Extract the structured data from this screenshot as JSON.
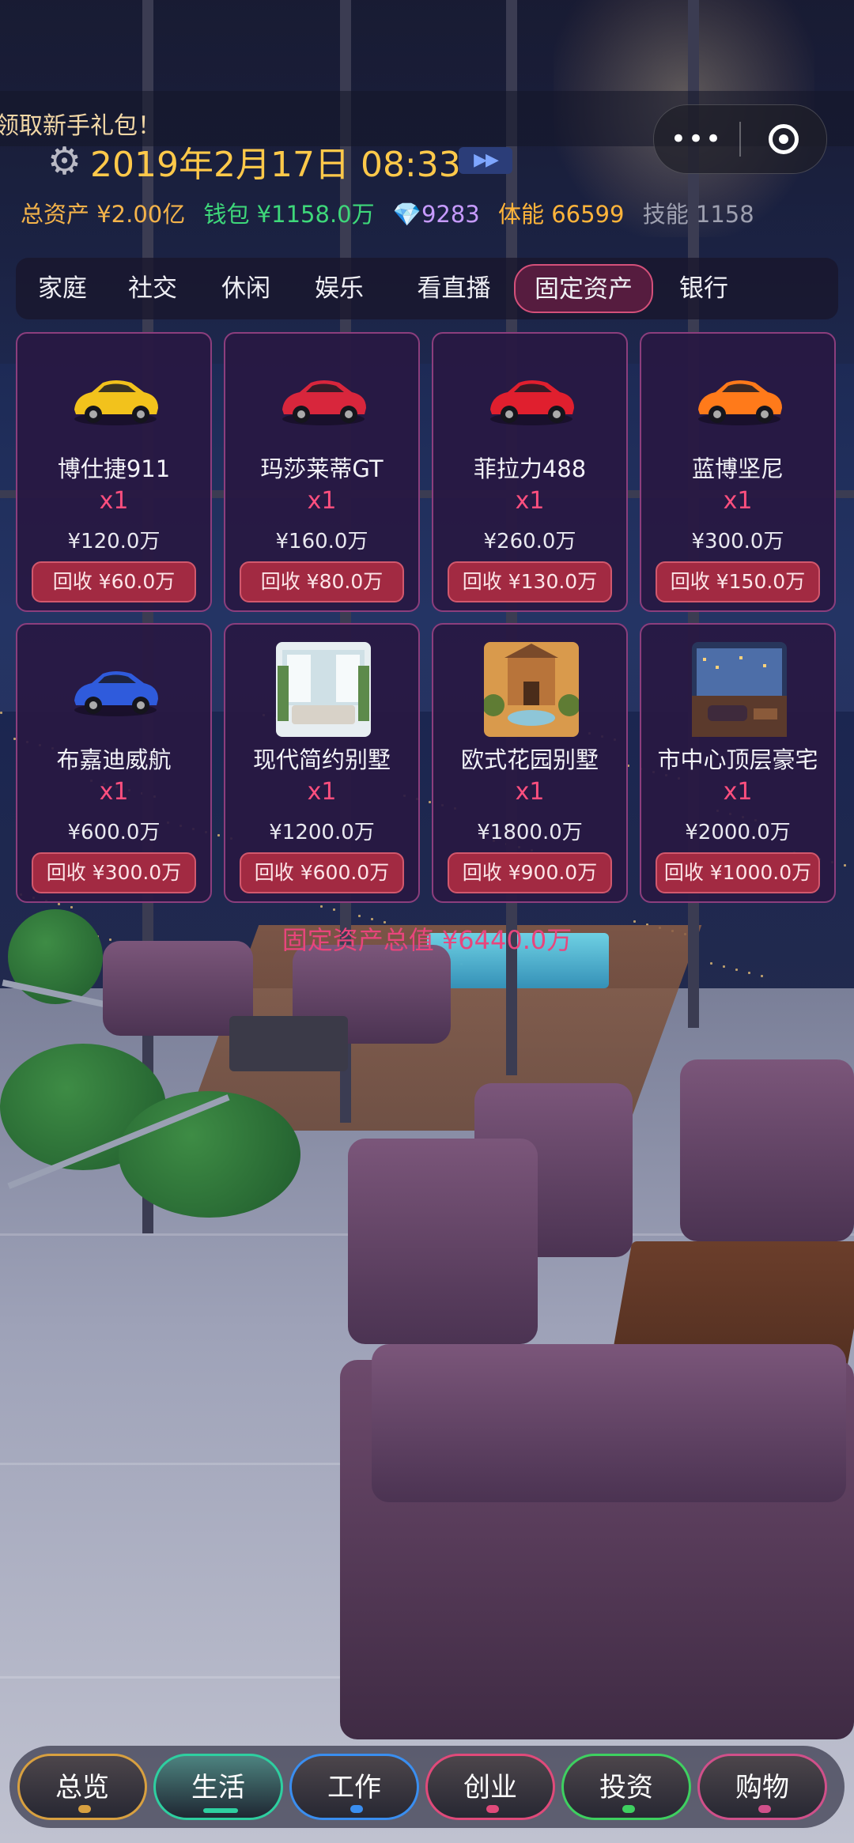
{
  "ticker": "领取新手礼包！",
  "capsule": {
    "more": "•••"
  },
  "header": {
    "date": "2019年2月17日 08:33",
    "speed": "▶▶"
  },
  "stats": {
    "total": "总资产 ¥2.00亿",
    "wallet": "钱包 ¥1158.0万",
    "gems": "💎9283",
    "stamina": "体能 66599",
    "skill": "技能 1158"
  },
  "tabs": [
    "家庭",
    "社交",
    "休闲",
    "娱乐",
    "看直播",
    "固定资产",
    "银行"
  ],
  "active_tab": "固定资产",
  "assets": [
    {
      "name": "博仕捷911",
      "qty": "x1",
      "price": "¥120.0万",
      "sell": "回收 ¥60.0万",
      "icon": "yellow-sports-car-icon",
      "color": "#f2c21c"
    },
    {
      "name": "玛莎莱蒂GT",
      "qty": "x1",
      "price": "¥160.0万",
      "sell": "回收 ¥80.0万",
      "icon": "red-coupe-icon",
      "color": "#d8263c"
    },
    {
      "name": "菲拉力488",
      "qty": "x1",
      "price": "¥260.0万",
      "sell": "回收 ¥130.0万",
      "icon": "red-supercar-icon",
      "color": "#e01f2e"
    },
    {
      "name": "蓝博坚尼",
      "qty": "x1",
      "price": "¥300.0万",
      "sell": "回收 ¥150.0万",
      "icon": "orange-supercar-icon",
      "color": "#ff7a1a"
    },
    {
      "name": "布嘉迪威航",
      "qty": "x1",
      "price": "¥600.0万",
      "sell": "回收 ¥300.0万",
      "icon": "blue-hypercar-icon",
      "color": "#2f5bdc"
    },
    {
      "name": "现代简约别墅",
      "qty": "x1",
      "price": "¥1200.0万",
      "sell": "回收 ¥600.0万",
      "icon": "modern-villa-icon",
      "color": "#cfe3ea"
    },
    {
      "name": "欧式花园别墅",
      "qty": "x1",
      "price": "¥1800.0万",
      "sell": "回收 ¥900.0万",
      "icon": "garden-villa-icon",
      "color": "#c98a3a"
    },
    {
      "name": "市中心顶层豪宅",
      "qty": "x1",
      "price": "¥2000.0万",
      "sell": "回收 ¥1000.0万",
      "icon": "penthouse-icon",
      "color": "#4d6ea8"
    }
  ],
  "total": "固定资产总值 ¥6440.0万",
  "bottom_nav": [
    {
      "label": "总览",
      "color": "#d8a040"
    },
    {
      "label": "生活",
      "color": "#2ecfa0"
    },
    {
      "label": "工作",
      "color": "#3a8ef0"
    },
    {
      "label": "创业",
      "color": "#e04a7a"
    },
    {
      "label": "投资",
      "color": "#3ed060"
    },
    {
      "label": "购物",
      "color": "#d0508a"
    }
  ],
  "active_nav": "生活"
}
